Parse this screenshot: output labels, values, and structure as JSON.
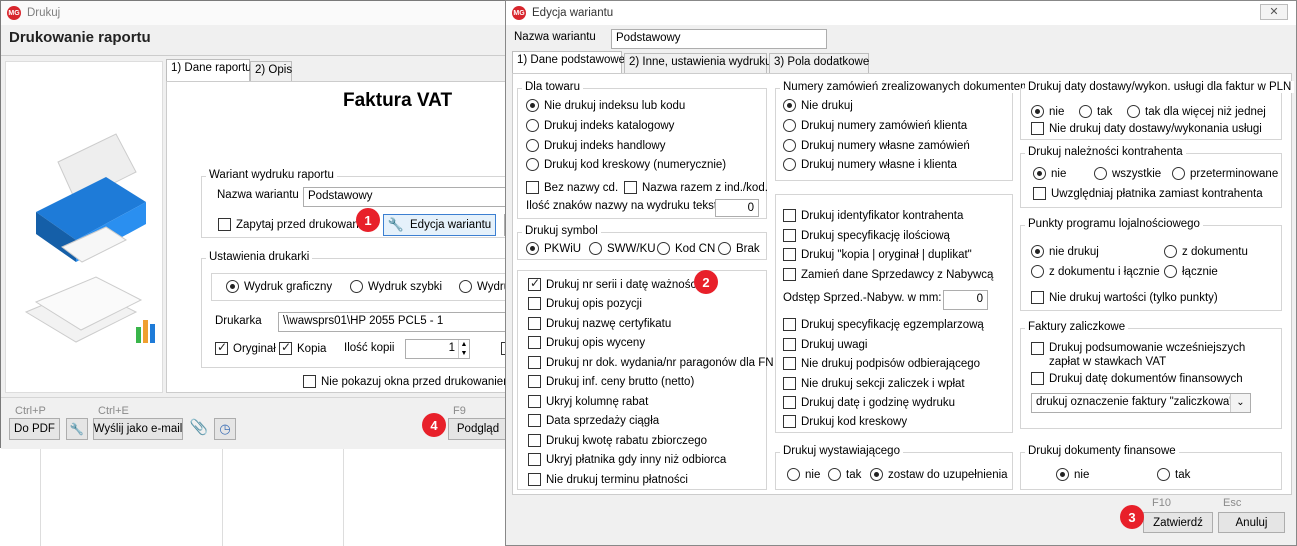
{
  "main_window": {
    "title": "Drukuj",
    "header": "Drukowanie raportu",
    "tabs": [
      "1) Dane raportu",
      "2) Opis"
    ],
    "report_title": "Faktura VAT",
    "variant_group": "Wariant wydruku raportu",
    "variant_name_label": "Nazwa wariantu",
    "variant_name_value": "Podstawowy",
    "ask_before_print": "Zapytaj przed drukowaniem",
    "edit_variant_button": "Edycja wariantu",
    "printer_group": "Ustawienia drukarki",
    "print_modes": [
      "Wydruk graficzny",
      "Wydruk szybki",
      "Wydru"
    ],
    "printer_label": "Drukarka",
    "printer_value": "\\\\wawsprs01\\HP 2055 PCL5 - 1",
    "original_label": "Oryginał",
    "copy_label": "Kopia",
    "copies_label": "Ilość kopii",
    "copies_value": "1",
    "hide_window": "Nie pokazuj okna przed drukowaniem",
    "shortcut_pdf": "Ctrl+P",
    "shortcut_email": "Ctrl+E",
    "shortcut_preview": "F9",
    "pdf_button": "Do PDF",
    "email_button": "Wyślij jako e-mail",
    "preview_button": "Podgląd"
  },
  "dialog": {
    "title": "Edycja wariantu",
    "name_label": "Nazwa wariantu",
    "name_value": "Podstawowy",
    "tabs": [
      "1) Dane podstawowe",
      "2) Inne, ustawienia wydruku",
      "3) Pola dodatkowe"
    ],
    "product": {
      "label": "Dla towaru",
      "options": [
        "Nie drukuj indeksu lub kodu",
        "Drukuj indeks katalogowy",
        "Drukuj indeks handlowy",
        "Drukuj kod kreskowy (numerycznie)"
      ],
      "no_name": "Bez nazwy cd.",
      "name_with_index": "Nazwa razem z ind./kod.",
      "chars_label": "Ilość znaków nazwy na wydruku tekst.",
      "chars_value": "0"
    },
    "symbol": {
      "label": "Drukuj symbol",
      "options": [
        "PKWiU",
        "SWW/KU",
        "Kod CN",
        "Brak"
      ]
    },
    "left_checks": [
      "Drukuj nr serii i datę ważności",
      "Drukuj opis pozycji",
      "Drukuj nazwę certyfikatu",
      "Drukuj opis wyceny",
      "Drukuj nr dok. wydania/nr paragonów dla FN",
      "Drukuj inf. ceny brutto (netto)",
      "Ukryj kolumnę rabat",
      "Data sprzedaży ciągła",
      "Drukuj kwotę rabatu zbiorczego",
      "Ukryj płatnika gdy inny niż odbiorca",
      "Nie drukuj terminu płatności"
    ],
    "orders": {
      "label": "Numery zamówień zrealizowanych dokumentem",
      "options": [
        "Nie drukuj",
        "Drukuj numery zamówień klienta",
        "Drukuj numery własne zamówień",
        "Drukuj numery własne i klienta"
      ]
    },
    "mid_checks_a": [
      "Drukuj identyfikator kontrahenta",
      "Drukuj specyfikację ilościową",
      "Drukuj \"kopia | oryginał | duplikat\"",
      "Zamień dane Sprzedawcy z Nabywcą"
    ],
    "offset_label": "Odstęp Sprzed.-Nabyw. w mm:",
    "offset_value": "0",
    "mid_checks_b": [
      "Drukuj specyfikację egzemplarzową",
      "Drukuj uwagi",
      "Nie drukuj podpisów odbierającego",
      "Nie drukuj sekcji zaliczek i wpłat",
      "Drukuj datę i godzinę wydruku",
      "Drukuj kod kreskowy"
    ],
    "issuer": {
      "label": "Drukuj wystawiającego",
      "options": [
        "nie",
        "tak",
        "zostaw do uzupełnienia"
      ]
    },
    "delivery": {
      "label": "Drukuj daty dostawy/wykon. usługi dla faktur w PLN",
      "options": [
        "nie",
        "tak",
        "tak dla więcej niż jednej"
      ],
      "check": "Nie drukuj daty dostawy/wykonania usługi"
    },
    "dues": {
      "label": "Drukuj należności kontrahenta",
      "options": [
        "nie",
        "wszystkie",
        "przeterminowane"
      ],
      "check": "Uwzględniaj płatnika zamiast kontrahenta"
    },
    "loyalty": {
      "label": "Punkty programu lojalnościowego",
      "options": [
        "nie drukuj",
        "z dokumentu",
        "z dokumentu i łącznie",
        "łącznie"
      ],
      "check": "Nie drukuj wartości (tylko punkty)"
    },
    "advance": {
      "label": "Faktury zaliczkowe",
      "check1": "Drukuj podsumowanie  wcześniejszych zapłat w stawkach VAT",
      "check2": "Drukuj datę dokumentów  finansowych",
      "select": "drukuj oznaczenie faktury \"zaliczkowa\""
    },
    "finance": {
      "label": "Drukuj dokumenty finansowe",
      "options": [
        "nie",
        "tak"
      ]
    },
    "hint_ok": "F10",
    "hint_cancel": "Esc",
    "ok_button": "Zatwierdź",
    "cancel_button": "Anuluj"
  },
  "badges": [
    "1",
    "2",
    "3",
    "4"
  ]
}
